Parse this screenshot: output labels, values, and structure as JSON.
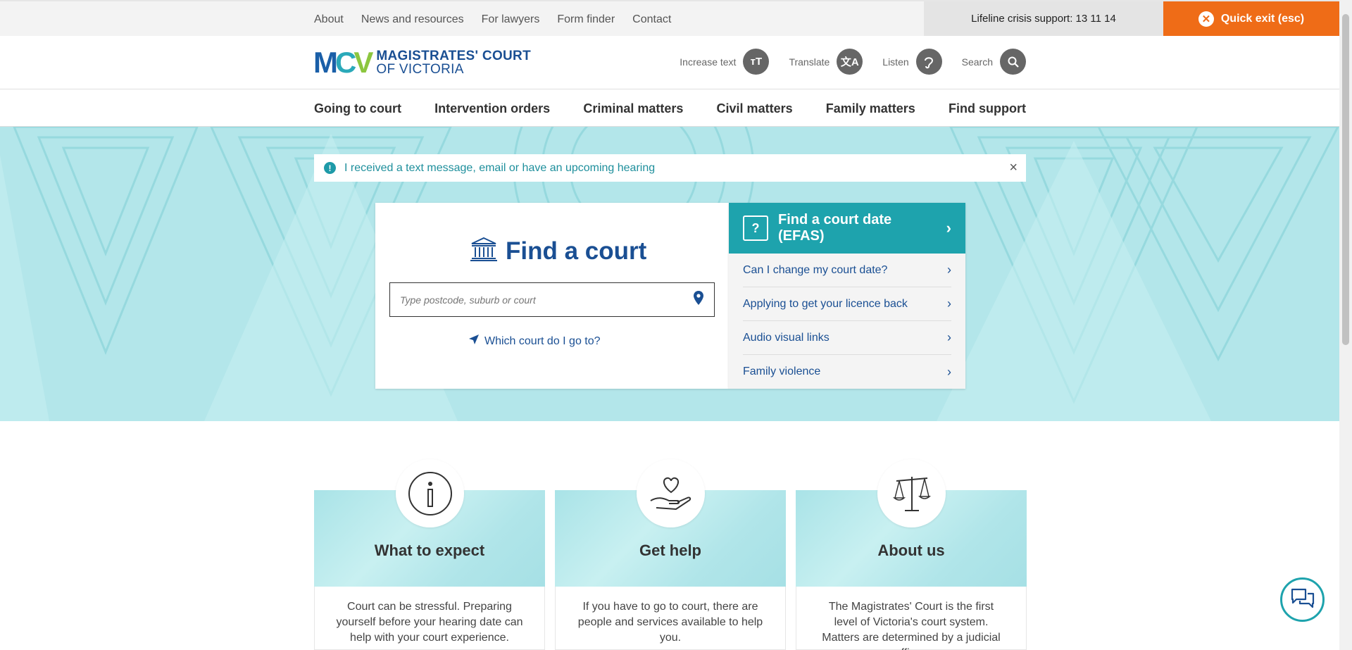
{
  "topbar": {
    "links": [
      "About",
      "News and resources",
      "For lawyers",
      "Form finder",
      "Contact"
    ],
    "lifeline": "Lifeline crisis support: 13 11 14",
    "quick_exit": "Quick exit (esc)"
  },
  "header": {
    "logo_line1": "MAGISTRATES' COURT",
    "logo_line2": "OF VICTORIA",
    "tools": {
      "increase_text": "Increase text",
      "translate": "Translate",
      "listen": "Listen",
      "search": "Search"
    }
  },
  "nav": {
    "items": [
      "Going to court",
      "Intervention orders",
      "Criminal matters",
      "Civil matters",
      "Family matters",
      "Find support"
    ]
  },
  "alert": {
    "message": "I received a text message, email or have an upcoming hearing"
  },
  "find_court": {
    "title": "Find a court",
    "placeholder": "Type postcode, suburb or court",
    "which_link": "Which court do I go to?"
  },
  "efas": {
    "heading": "Find a court date (EFAS)",
    "links": [
      "Can I change my court date?",
      "Applying to get your licence back",
      "Audio visual links",
      "Family violence"
    ]
  },
  "cards": [
    {
      "title": "What to expect",
      "text": "Court can be stressful. Preparing yourself before your hearing date can help with your court experience."
    },
    {
      "title": "Get help",
      "text": "If you have to go to court, there are people and services available to help you."
    },
    {
      "title": "About us",
      "text": "The Magistrates' Court is the first level of Victoria's court system. Matters are determined by a judicial officer."
    }
  ],
  "colors": {
    "accent_teal": "#1ea3ad",
    "brand_blue": "#1a4f93",
    "quick_exit_orange": "#ef6c17",
    "hero_bg": "#b3e6ea"
  }
}
